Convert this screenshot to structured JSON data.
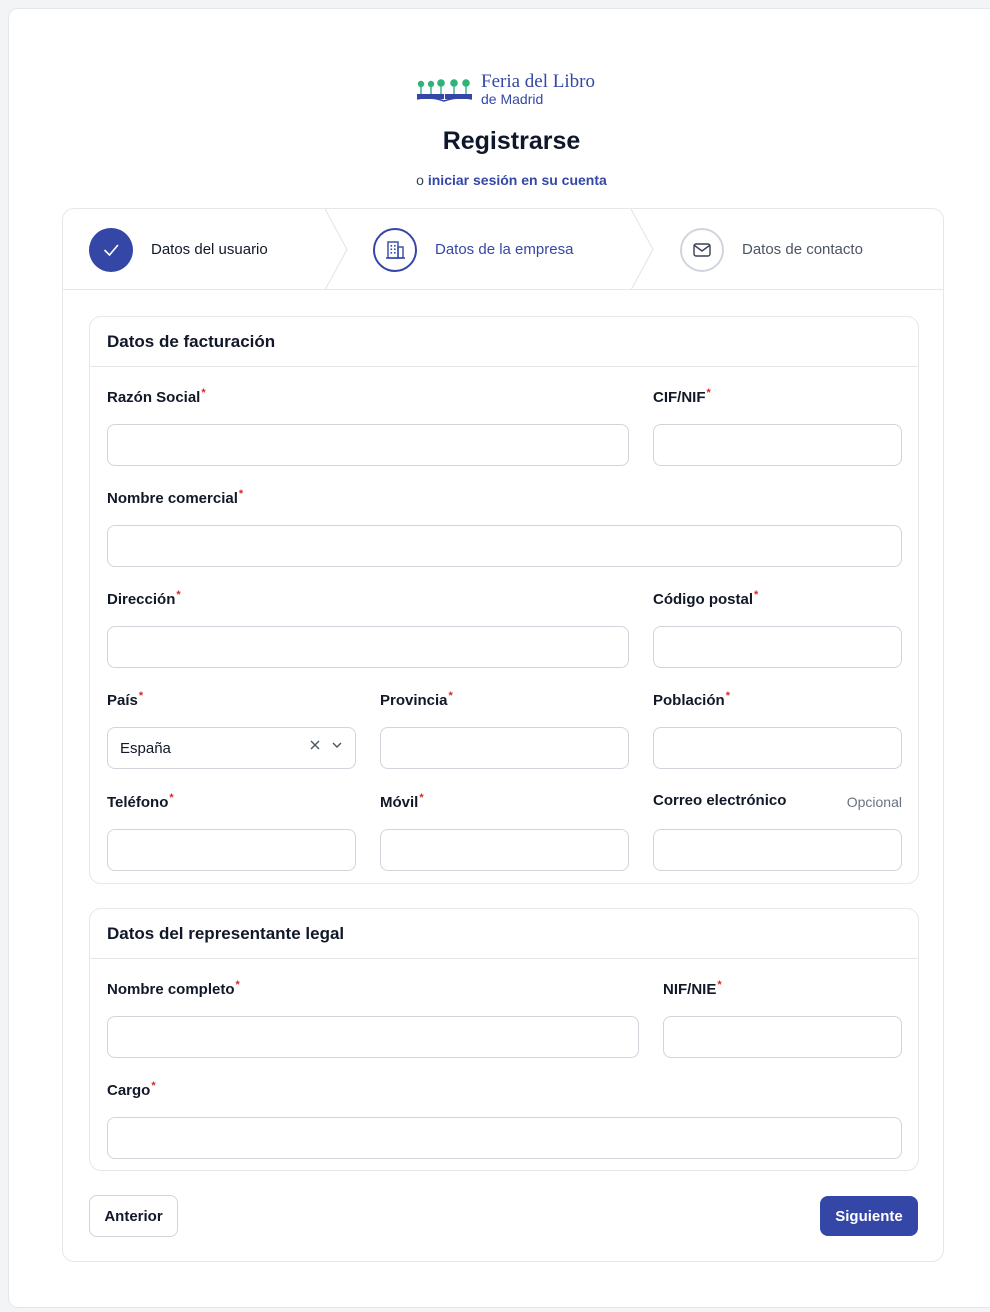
{
  "brand": {
    "name": "Feria del Libro",
    "sub": "de Madrid",
    "color": "#3447a7"
  },
  "header": {
    "title": "Registrarse",
    "subtitle_prefix": "o",
    "login_link": "iniciar sesión en su cuenta"
  },
  "steps": [
    {
      "label": "Datos del usuario",
      "icon": "check-icon",
      "status": "complete"
    },
    {
      "label": "Datos de la empresa",
      "icon": "building-icon",
      "status": "current"
    },
    {
      "label": "Datos de contacto",
      "icon": "envelope-icon",
      "status": "upcoming"
    }
  ],
  "billing": {
    "title": "Datos de facturación",
    "razon_social": {
      "label": "Razón Social",
      "required": "*",
      "value": ""
    },
    "cif_nif": {
      "label": "CIF/NIF",
      "required": "*",
      "value": ""
    },
    "nombre_comercial": {
      "label": "Nombre comercial",
      "required": "*",
      "value": ""
    },
    "direccion": {
      "label": "Dirección",
      "required": "*",
      "value": ""
    },
    "codigo_postal": {
      "label": "Código postal",
      "required": "*",
      "value": ""
    },
    "pais": {
      "label": "País",
      "required": "*",
      "value": "España"
    },
    "provincia": {
      "label": "Provincia",
      "required": "*",
      "value": ""
    },
    "poblacion": {
      "label": "Población",
      "required": "*",
      "value": ""
    },
    "telefono": {
      "label": "Teléfono",
      "required": "*",
      "value": ""
    },
    "movil": {
      "label": "Móvil",
      "required": "*",
      "value": ""
    },
    "correo": {
      "label": "Correo electrónico",
      "optional": "Opcional",
      "value": ""
    }
  },
  "legal": {
    "title": "Datos del representante legal",
    "nombre_completo": {
      "label": "Nombre completo",
      "required": "*",
      "value": ""
    },
    "nif_nie": {
      "label": "NIF/NIE",
      "required": "*",
      "value": ""
    },
    "cargo": {
      "label": "Cargo",
      "required": "*",
      "value": ""
    }
  },
  "actions": {
    "prev": "Anterior",
    "next": "Siguiente"
  }
}
